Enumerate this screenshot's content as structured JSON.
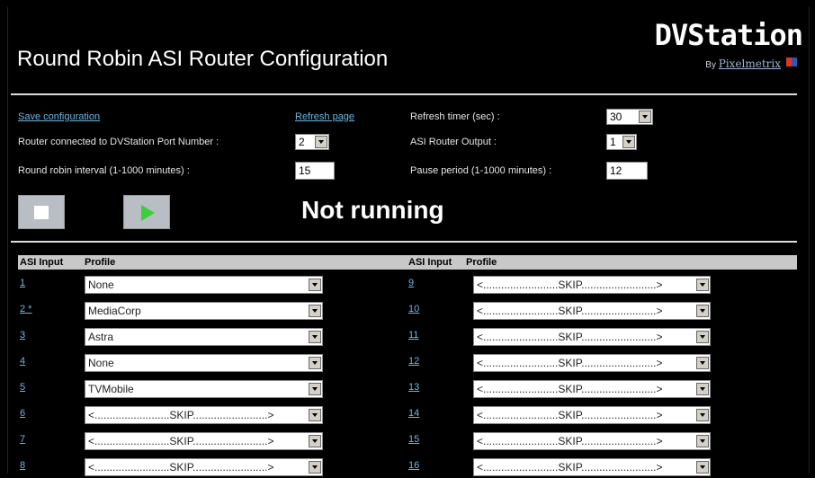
{
  "page": {
    "title": "Round Robin ASI Router Configuration"
  },
  "logo": {
    "name": "DVStation",
    "by": "By",
    "brand": "Pixelmetrix"
  },
  "links": {
    "save": "Save configuration",
    "refresh": "Refresh page"
  },
  "settings": {
    "router_port_label": "Router connected to DVStation Port Number :",
    "router_port_value": "2",
    "rr_interval_label": "Round robin interval (1-1000 minutes) :",
    "rr_interval_value": "15",
    "refresh_timer_label": "Refresh timer (sec) :",
    "refresh_timer_value": "30",
    "asi_output_label": "ASI Router Output :",
    "asi_output_value": "1",
    "pause_label": "Pause period (1-1000 minutes) :",
    "pause_value": "12"
  },
  "status": "Not running",
  "table": {
    "col_input": "ASI Input",
    "col_profile": "Profile",
    "left": [
      {
        "num": "1",
        "profile": "None"
      },
      {
        "num": "2 *",
        "profile": "MediaCorp"
      },
      {
        "num": "3",
        "profile": "Astra"
      },
      {
        "num": "4",
        "profile": "None"
      },
      {
        "num": "5",
        "profile": "TVMobile"
      },
      {
        "num": "6",
        "profile": "<.........................SKIP.........................>"
      },
      {
        "num": "7",
        "profile": "<.........................SKIP.........................>"
      },
      {
        "num": "8",
        "profile": "<.........................SKIP.........................>"
      }
    ],
    "right": [
      {
        "num": "9",
        "profile": "<.........................SKIP.........................>"
      },
      {
        "num": "10",
        "profile": "<.........................SKIP.........................>"
      },
      {
        "num": "11",
        "profile": "<.........................SKIP.........................>"
      },
      {
        "num": "12",
        "profile": "<.........................SKIP.........................>"
      },
      {
        "num": "13",
        "profile": "<.........................SKIP.........................>"
      },
      {
        "num": "14",
        "profile": "<.........................SKIP.........................>"
      },
      {
        "num": "15",
        "profile": "<.........................SKIP.........................>"
      },
      {
        "num": "16",
        "profile": "<.........................SKIP.........................>"
      }
    ]
  }
}
